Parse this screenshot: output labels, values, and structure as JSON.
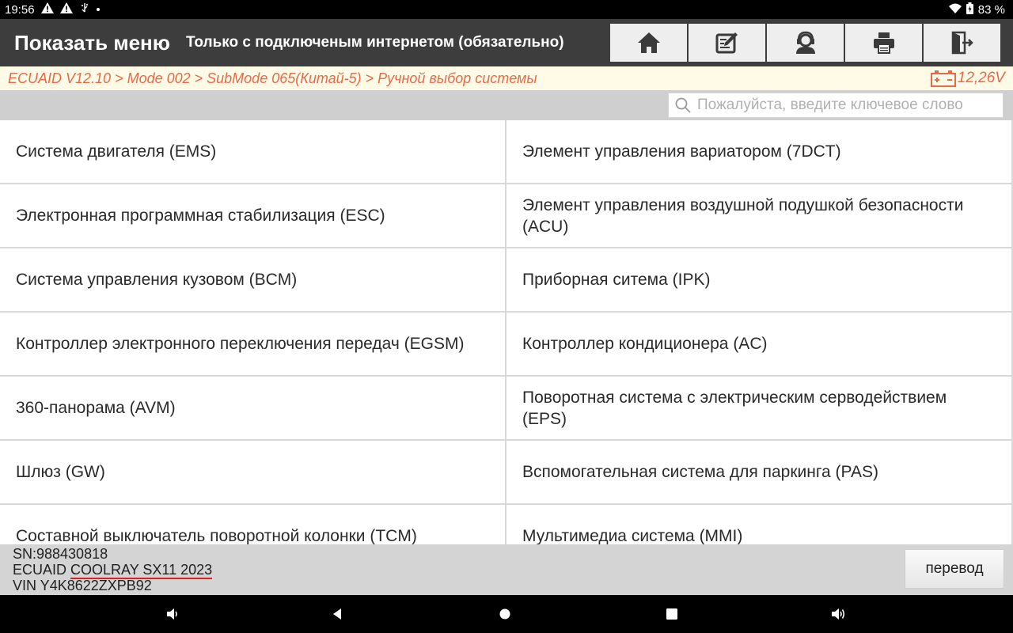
{
  "status_bar": {
    "time": "19:56",
    "battery": "83 %",
    "left_icons": [
      "warning-icon",
      "warning-icon",
      "usb-icon",
      "dot-icon"
    ],
    "right_icons": [
      "wifi-icon",
      "battery-icon"
    ]
  },
  "header": {
    "title": "Показать меню",
    "subtitle": "Только с подключеным интернетом (обязательно)",
    "toolbar": [
      "home-icon",
      "edit-icon",
      "support-icon",
      "print-icon",
      "exit-icon"
    ]
  },
  "breadcrumb": {
    "path": "ECUAID V12.10 > Mode 002 > SubMode 065(Китай-5) > Ручной выбор системы",
    "voltage": "12,26V"
  },
  "search": {
    "placeholder": "Пожалуйста, введите ключевое слово"
  },
  "systems": [
    "Система двигателя (EMS)",
    "Элемент управления вариатором (7DCT)",
    "Электронная программная стабилизация (ESC)",
    "Элемент управления  воздушной подушкой безопасности (ACU)",
    "Система управления кузовом (BCM)",
    "Приборная ситема  (IPK)",
    "Контроллер электронного переключения передач (EGSM)",
    "Контроллер кондиционера (AC)",
    "360-панорама (AVM)",
    "Поворотная система с электрическим серводействием (EPS)",
    "Шлюз (GW)",
    "Вспомогательная система для паркинга (PAS)",
    "Составной выключатель поворотной колонки (TCM)",
    "Мультимедиа система (MMI)"
  ],
  "footer": {
    "sn": "SN:988430818",
    "ecuaid_prefix": "ECUAID ",
    "vehicle": "COOLRAY SX11 2023",
    "vin": "VIN Y4K8622ZXPB92",
    "translate_label": "перевод"
  },
  "colors": {
    "header_bg": "#3d3d3d",
    "breadcrumb_text": "#e8694a",
    "breadcrumb_bg": "#fffbe6",
    "underline": "#e02020"
  }
}
